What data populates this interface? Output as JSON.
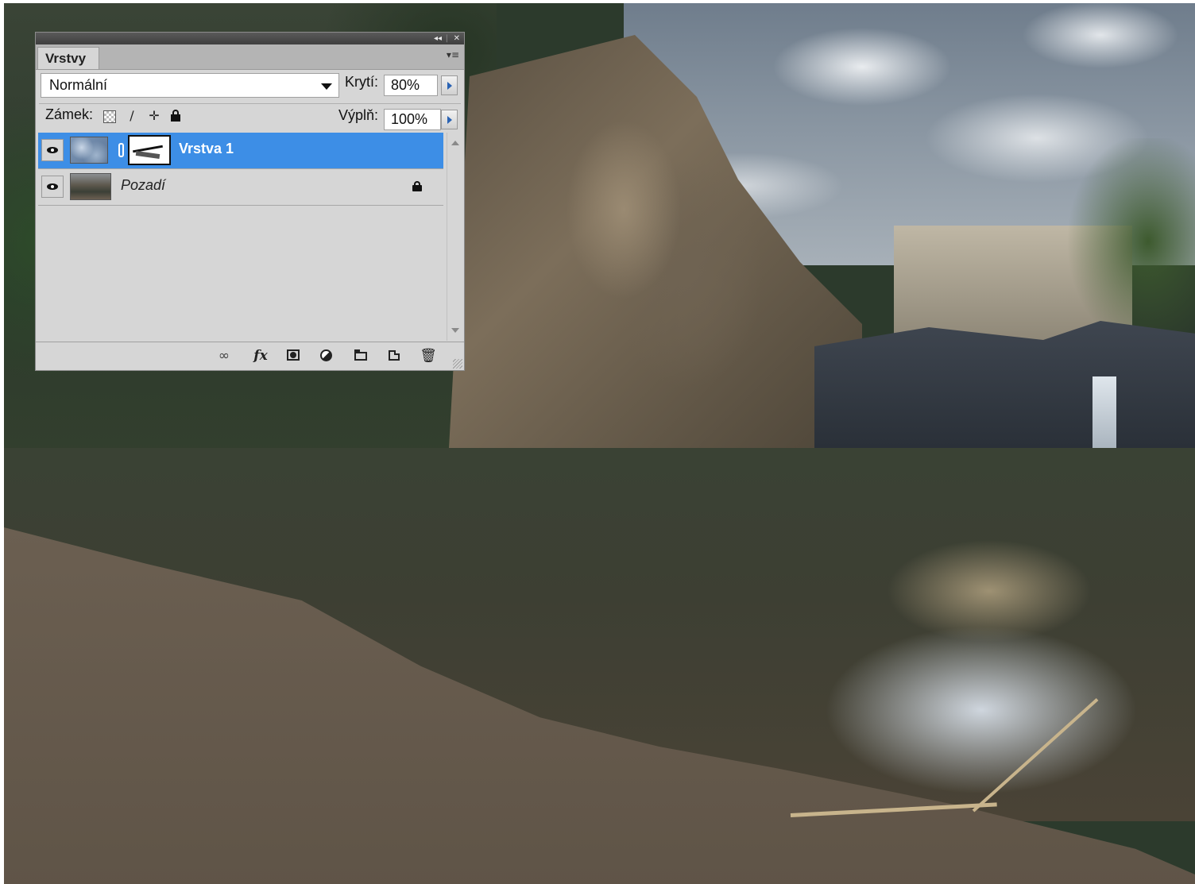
{
  "panel": {
    "tab_label": "Vrstvy",
    "collapse_glyph": "◂◂",
    "close_glyph": "✕",
    "menu_glyph": "▾≡",
    "blend_mode": "Normální",
    "opacity_label": "Krytí:",
    "opacity_value": "80%",
    "lock_label": "Zámek:",
    "fill_label": "Výplň:",
    "fill_value": "100%",
    "lock_icons": [
      "lock-transparent-pixels-icon",
      "lock-image-pixels-icon",
      "lock-position-icon",
      "lock-all-icon"
    ],
    "layers": [
      {
        "name": "Vrstva 1",
        "visible": true,
        "selected": true,
        "has_mask": true,
        "locked": false
      },
      {
        "name": "Pozadí",
        "visible": true,
        "selected": false,
        "has_mask": false,
        "locked": true
      }
    ],
    "bottom_icons": [
      "link-layers-icon",
      "fx-icon",
      "add-mask-icon",
      "adjustment-layer-icon",
      "new-group-icon",
      "new-layer-icon",
      "trash-icon"
    ],
    "fx_glyph": "fx",
    "accent_color": "#3d8ee6"
  }
}
